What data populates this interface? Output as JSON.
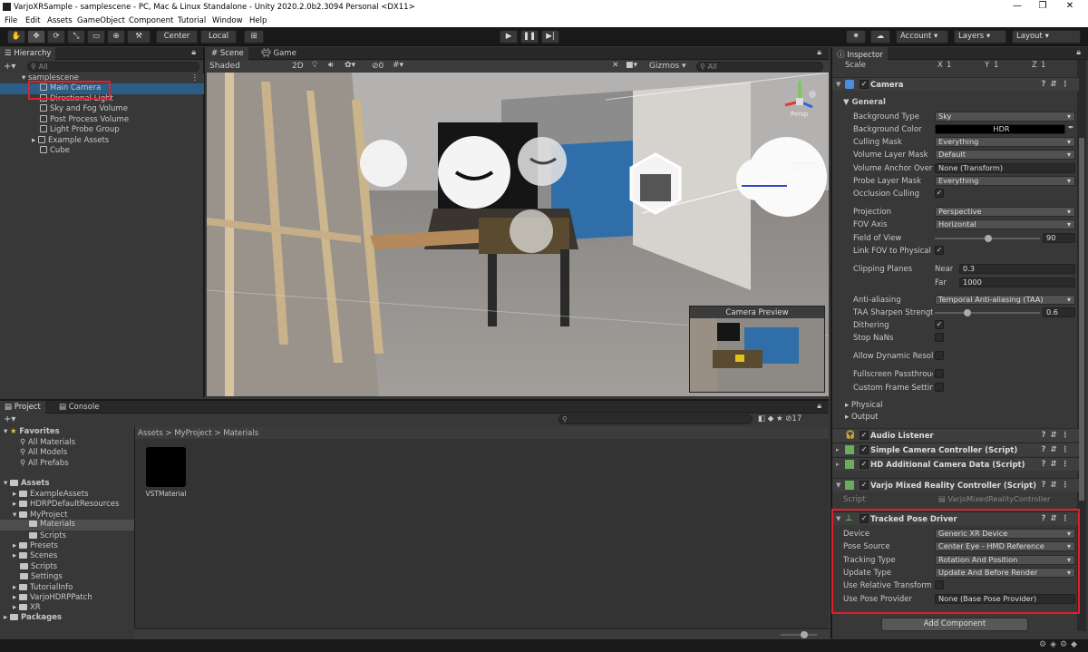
{
  "window": {
    "title": "VarjoXRSample - samplescene - PC, Mac & Linux Standalone - Unity 2020.2.0b2.3094 Personal <DX11>"
  },
  "menu": [
    "File",
    "Edit",
    "Assets",
    "GameObject",
    "Component",
    "Tutorial",
    "Window",
    "Help"
  ],
  "toolbar": {
    "pivot": "Center",
    "space": "Local",
    "account": "Account",
    "layers": "Layers",
    "layout": "Layout"
  },
  "hierarchy": {
    "tab": "Hierarchy",
    "search_placeholder": "All",
    "scene": "samplescene",
    "items": [
      "Main Camera",
      "Directional Light",
      "Sky and Fog Volume",
      "Post Process Volume",
      "Light Probe Group",
      "Example Assets",
      "Cube"
    ]
  },
  "sceneview": {
    "tabs": [
      "Scene",
      "Game"
    ],
    "shading": "Shaded",
    "mode2d": "2D",
    "layers_count": "0",
    "gizmos": "Gizmos",
    "search_placeholder": "All",
    "persp": "Persp",
    "preview_title": "Camera Preview"
  },
  "inspector": {
    "tab": "Inspector",
    "scale": {
      "label": "Scale",
      "x": "1",
      "y": "1",
      "z": "1"
    },
    "camera": {
      "title": "Camera",
      "section": "General",
      "rows": [
        {
          "label": "Background Type",
          "value": "Sky"
        },
        {
          "label": "Background Color",
          "value": "HDR"
        },
        {
          "label": "Culling Mask",
          "value": "Everything"
        },
        {
          "label": "Volume Layer Mask",
          "value": "Default"
        },
        {
          "label": "Volume Anchor Overri",
          "value": "None (Transform)"
        },
        {
          "label": "Probe Layer Mask",
          "value": "Everything"
        },
        {
          "label": "Occlusion Culling",
          "value": "✓"
        },
        {
          "label": "Projection",
          "value": "Perspective"
        },
        {
          "label": "FOV Axis",
          "value": "Horizontal"
        },
        {
          "label": "Field of View",
          "value": "90"
        },
        {
          "label": "Link FOV to Physical C",
          "value": "✓"
        },
        {
          "label": "Clipping Planes",
          "near_label": "Near",
          "near": "0.3",
          "far_label": "Far",
          "far": "1000"
        },
        {
          "label": "Anti-aliasing",
          "value": "Temporal Anti-aliasing (TAA)"
        },
        {
          "label": "TAA Sharpen Strength",
          "value": "0.6"
        },
        {
          "label": "Dithering",
          "value": "✓"
        },
        {
          "label": "Stop NaNs",
          "value": ""
        },
        {
          "label": "Allow Dynamic Resolu",
          "value": ""
        },
        {
          "label": "Fullscreen Passthroug",
          "value": ""
        },
        {
          "label": "Custom Frame Setting",
          "value": ""
        }
      ],
      "physical": "Physical",
      "output": "Output"
    },
    "components": [
      "Audio Listener",
      "Simple Camera Controller (Script)",
      "HD Additional Camera Data (Script)",
      "Varjo Mixed Reality Controller (Script)"
    ],
    "script": {
      "label": "Script",
      "value": "VarjoMixedRealityController"
    },
    "tracked": {
      "title": "Tracked Pose Driver",
      "rows": [
        {
          "label": "Device",
          "value": "Generic XR Device"
        },
        {
          "label": "Pose Source",
          "value": "Center Eye - HMD Reference"
        },
        {
          "label": "Tracking Type",
          "value": "Rotation And Position"
        },
        {
          "label": "Update Type",
          "value": "Update And Before Render"
        },
        {
          "label": "Use Relative Transform",
          "value": ""
        },
        {
          "label": "Use Pose Provider",
          "value": "None (Base Pose Provider)"
        }
      ]
    },
    "add_component": "Add Component"
  },
  "project": {
    "tabs": [
      "Project",
      "Console"
    ],
    "count": "17",
    "favorites": {
      "label": "Favorites",
      "items": [
        "All Materials",
        "All Models",
        "All Prefabs"
      ]
    },
    "assets": {
      "label": "Assets",
      "items": [
        "ExampleAssets",
        "HDRPDefaultResources",
        "MyProject",
        "Materials",
        "Scripts",
        "Presets",
        "Scenes",
        "Scripts",
        "Settings",
        "TutorialInfo",
        "VarjoHDRPPatch",
        "XR"
      ]
    },
    "packages": "Packages",
    "breadcrumb": [
      "Assets",
      "MyProject",
      "Materials"
    ],
    "material": "VSTMaterial"
  },
  "colors": {
    "accent": "#2c5d87",
    "highlight": "#e0202a"
  }
}
